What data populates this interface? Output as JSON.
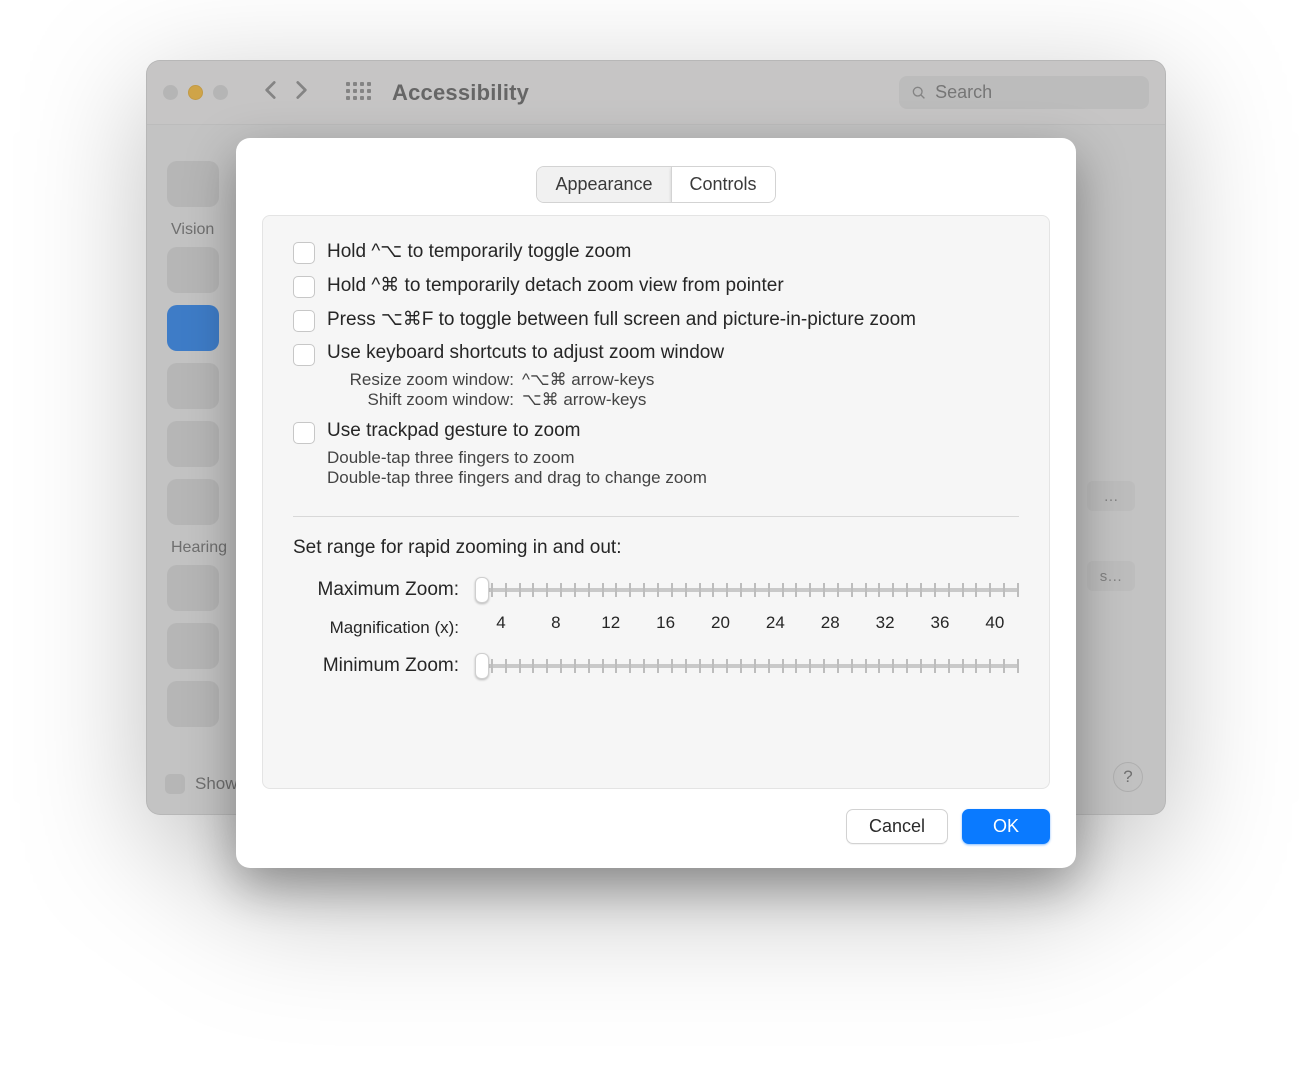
{
  "window": {
    "title": "Accessibility",
    "search_placeholder": "Search"
  },
  "sidebar": {
    "group_vision": "Vision",
    "group_hearing": "Hearing",
    "items": [
      {
        "id": "overview",
        "icon": "accessibility",
        "color": "#0a7aff"
      },
      {
        "id": "voiceover",
        "icon": "voiceover",
        "color": "#3a3a3a"
      },
      {
        "id": "zoom",
        "icon": "zoom",
        "color": "#0a7aff",
        "active": true
      },
      {
        "id": "display",
        "icon": "display",
        "color": "#0a7aff"
      },
      {
        "id": "speech",
        "icon": "speech",
        "color": "#3a3a3a"
      },
      {
        "id": "descriptions",
        "icon": "descriptions",
        "color": "#0a7aff"
      },
      {
        "id": "audio",
        "icon": "audio",
        "color": "#5aa23a"
      },
      {
        "id": "rtt",
        "icon": "rtt",
        "color": "#00b386"
      },
      {
        "id": "captions",
        "icon": "captions",
        "color": "#0a7aff"
      }
    ],
    "show_label": "Show"
  },
  "tabs": {
    "appearance": "Appearance",
    "controls": "Controls",
    "active": "controls"
  },
  "options": {
    "hold_ctrl_opt": "Hold ^⌥ to temporarily toggle zoom",
    "hold_ctrl_cmd": "Hold ^⌘ to temporarily detach zoom view from pointer",
    "press_opt_cmd_f": "Press ⌥⌘F to toggle between full screen and picture-in-picture zoom",
    "kb_shortcuts": "Use keyboard shortcuts to adjust zoom window",
    "kb_resize_label": "Resize zoom window:",
    "kb_resize_keys": "^⌥⌘ arrow-keys",
    "kb_shift_label": "Shift zoom window:",
    "kb_shift_keys": "⌥⌘ arrow-keys",
    "trackpad": "Use trackpad gesture to zoom",
    "trackpad_sub1": "Double-tap three fingers to zoom",
    "trackpad_sub2": "Double-tap three fingers and drag to change zoom"
  },
  "zoom_range": {
    "section_title": "Set range for rapid zooming in and out:",
    "max_label": "Maximum Zoom:",
    "mag_label": "Magnification (x):",
    "min_label": "Minimum Zoom:",
    "labels": [
      "4",
      "8",
      "12",
      "16",
      "20",
      "24",
      "28",
      "32",
      "36",
      "40"
    ],
    "tick_count": 40,
    "max_pos_pct": 1,
    "min_pos_pct": 1
  },
  "buttons": {
    "cancel": "Cancel",
    "ok": "OK"
  },
  "bg_buttons": {
    "ellipsis1": "…",
    "ellipsis2": "s…"
  },
  "help": "?"
}
